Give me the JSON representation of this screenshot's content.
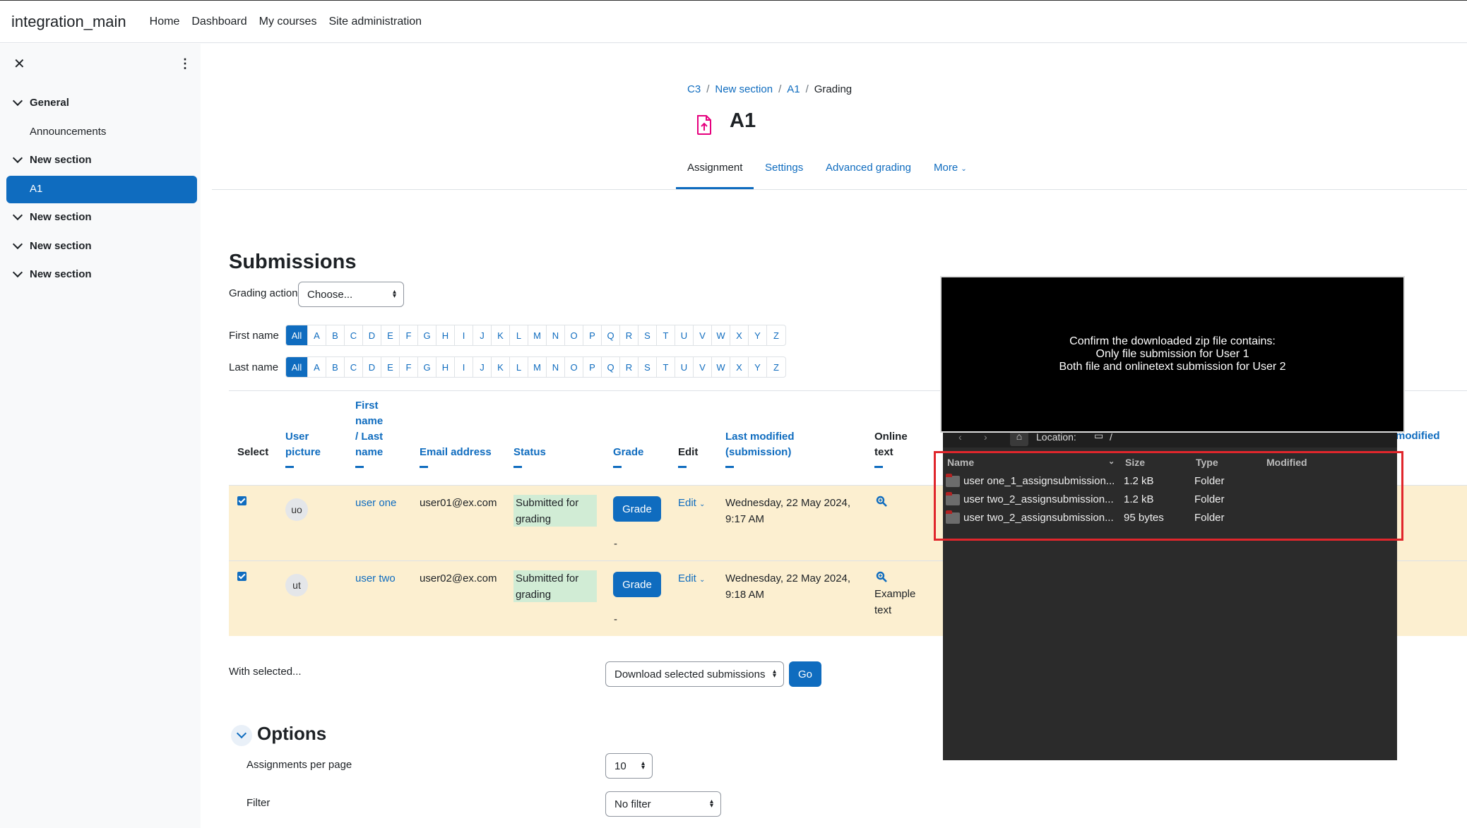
{
  "navbar": {
    "brand": "integration_main",
    "links": [
      "Home",
      "Dashboard",
      "My courses",
      "Site administration"
    ]
  },
  "drawer": {
    "close": "✕",
    "kebab": "⋮",
    "items": [
      {
        "label": "General"
      },
      {
        "label": "Announcements"
      },
      {
        "label": "New section"
      },
      {
        "label": "A1"
      },
      {
        "label": "New section"
      },
      {
        "label": "New section"
      },
      {
        "label": "New section"
      }
    ]
  },
  "breadcrumb": [
    "C3",
    "New section",
    "A1",
    "Grading"
  ],
  "page": {
    "title": "A1"
  },
  "tabs": [
    "Assignment",
    "Settings",
    "Advanced grading",
    "More"
  ],
  "submissions": {
    "title": "Submissions",
    "grading_action_label": "Grading action",
    "grading_action_value": "Choose...",
    "first_name_label": "First name",
    "last_name_label": "Last name",
    "letters": [
      "All",
      "A",
      "B",
      "C",
      "D",
      "E",
      "F",
      "G",
      "H",
      "I",
      "J",
      "K",
      "L",
      "M",
      "N",
      "O",
      "P",
      "Q",
      "R",
      "S",
      "T",
      "U",
      "V",
      "W",
      "X",
      "Y",
      "Z"
    ]
  },
  "table": {
    "headers": {
      "select": "Select",
      "user_picture_1": "User",
      "user_picture_2": "picture",
      "name_1": "First",
      "name_2": "name",
      "name_3": "/ Last",
      "name_4": "name",
      "email": "Email address",
      "status": "Status",
      "grade": "Grade",
      "edit": "Edit",
      "last_modified_1": "Last modified",
      "last_modified_2": "(submission)",
      "online_1": "Online",
      "online_2": "text",
      "right_frag": "modified"
    },
    "rows": [
      {
        "initials": "uo",
        "name": "user one",
        "email": "user01@ex.com",
        "status_1": "Submitted for",
        "status_2": "grading",
        "grade_btn": "Grade",
        "grade_dash": "-",
        "edit": "Edit",
        "modified_1": "Wednesday, 22 May 2024,",
        "modified_2": "9:17 AM",
        "online_1": "",
        "online_2": ""
      },
      {
        "initials": "ut",
        "name": "user two",
        "email": "user02@ex.com",
        "status_1": "Submitted for",
        "status_2": "grading",
        "grade_btn": "Grade",
        "grade_dash": "-",
        "edit": "Edit",
        "modified_1": "Wednesday, 22 May 2024,",
        "modified_2": "9:18 AM",
        "online_1": "Example",
        "online_2": "text"
      }
    ]
  },
  "bulk": {
    "with_selected": "With selected...",
    "action": "Download selected submissions",
    "go": "Go"
  },
  "options": {
    "title": "Options",
    "per_page_label": "Assignments per page",
    "per_page_value": "10",
    "filter_label": "Filter",
    "filter_value": "No filter"
  },
  "overlay": {
    "instructions": [
      "Confirm the downloaded zip file contains:",
      "Only file submission for User 1",
      "Both file and onlinetext submission for User 2"
    ],
    "location_label": "Location:",
    "location_path": "/",
    "columns": [
      "Name",
      "Size",
      "Type",
      "Modified"
    ],
    "files": [
      {
        "name": "user one_1_assignsubmission...",
        "size": "1.2 kB",
        "type": "Folder"
      },
      {
        "name": "user two_2_assignsubmission...",
        "size": "1.2 kB",
        "type": "Folder"
      },
      {
        "name": "user two_2_assignsubmission...",
        "size": "95 bytes",
        "type": "Folder"
      }
    ],
    "highlight_color": "#e0262c"
  }
}
